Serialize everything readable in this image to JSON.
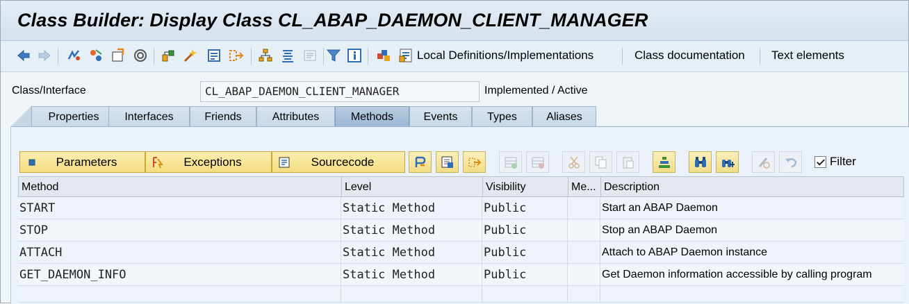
{
  "window": {
    "title": "Class Builder: Display Class CL_ABAP_DAEMON_CLIENT_MANAGER"
  },
  "toolbar": {
    "icons": [
      "back-icon",
      "forward-icon",
      "other-object-icon",
      "display-change-icon",
      "activate-icon",
      "where-used-icon",
      "graphic-icon",
      "check-icon",
      "object-list-icon",
      "navigation-icon",
      "hierarchy-icon",
      "object-directory-icon",
      "inactive-icon",
      "filter-icon",
      "info-icon",
      "local-types-icon"
    ],
    "local_defs_label": "Local Definitions/Implementations",
    "class_doc_label": "Class documentation",
    "text_elements_label": "Text elements"
  },
  "header": {
    "class_label": "Class/Interface",
    "class_value": "CL_ABAP_DAEMON_CLIENT_MANAGER",
    "status": "Implemented / Active"
  },
  "tabs": [
    {
      "label": "Properties"
    },
    {
      "label": "Interfaces"
    },
    {
      "label": "Friends"
    },
    {
      "label": "Attributes"
    },
    {
      "label": "Methods",
      "active": true
    },
    {
      "label": "Events"
    },
    {
      "label": "Types"
    },
    {
      "label": "Aliases"
    }
  ],
  "methods_toolbar": {
    "parameters_label": "Parameters",
    "exceptions_label": "Exceptions",
    "sourcecode_label": "Sourcecode",
    "filter_label": "Filter",
    "filter_checked": true
  },
  "grid": {
    "columns": [
      "Method",
      "Level",
      "Visibility",
      "Me...",
      "Description"
    ],
    "rows": [
      {
        "method": "START",
        "level": "Static Method",
        "visibility": "Public",
        "me": "",
        "description": "Start an ABAP Daemon"
      },
      {
        "method": "STOP",
        "level": "Static Method",
        "visibility": "Public",
        "me": "",
        "description": "Stop an ABAP Daemon"
      },
      {
        "method": "ATTACH",
        "level": "Static Method",
        "visibility": "Public",
        "me": "",
        "description": "Attach to ABAP Daemon instance"
      },
      {
        "method": "GET_DAEMON_INFO",
        "level": "Static Method",
        "visibility": "Public",
        "me": "",
        "description": "Get Daemon information accessible by calling program"
      },
      {
        "method": "",
        "level": "",
        "visibility": "",
        "me": "",
        "description": ""
      }
    ]
  },
  "colors": {
    "title_bg": "#dbe5ef",
    "button_yellow": "#f6e08c",
    "tab_active": "#a6c2dc",
    "icon_blue": "#2f6db5"
  }
}
